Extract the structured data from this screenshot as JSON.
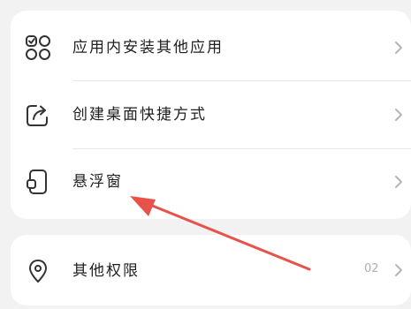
{
  "settings": {
    "items": [
      {
        "label": "应用内安装其他应用",
        "icon": "apps-grid-icon"
      },
      {
        "label": "创建桌面快捷方式",
        "icon": "share-shortcut-icon"
      },
      {
        "label": "悬浮窗",
        "icon": "floating-window-icon"
      }
    ],
    "other": {
      "label": "其他权限",
      "icon": "location-pin-icon",
      "value": "02"
    }
  },
  "annotation": {
    "type": "arrow",
    "color": "#e8524a",
    "target": "悬浮窗"
  },
  "colors": {
    "background": "#f2f2f2",
    "card": "#ffffff",
    "text": "#1f1f1f",
    "icon": "#333333",
    "chevron": "#b5b5b5",
    "divider": "#e6e6e6"
  }
}
